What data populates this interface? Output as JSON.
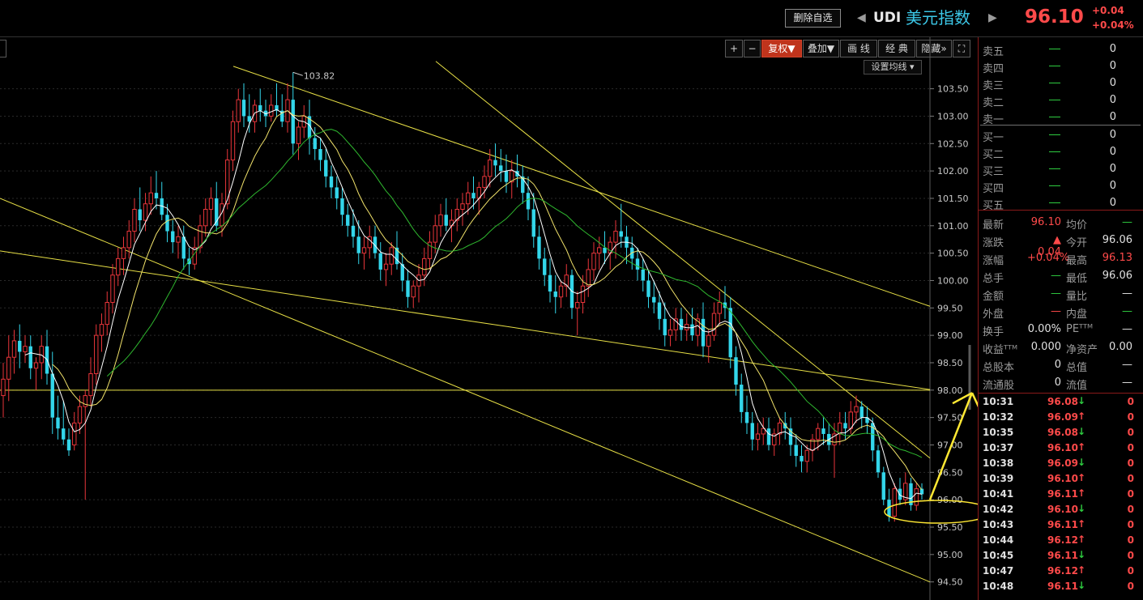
{
  "header": {
    "delete_btn": "删除自选",
    "prev_arrow": "◀",
    "next_arrow": "▶",
    "symbol": "UDI",
    "name": "美元指数",
    "price": "96.10",
    "change": "+0.04",
    "change_pct": "+0.04%"
  },
  "toolbar": {
    "items": [
      "+",
      "−",
      "复权▼",
      "叠加▼",
      "画 线",
      "经 典",
      "隐藏»",
      "⛶"
    ],
    "ma_setting": "设置均线 ▾"
  },
  "colors": {
    "up": "#e8353a",
    "down": "#33d6ea",
    "ma5": "#ffffff",
    "ma10": "#f2e36b",
    "ma20": "#2fb82f",
    "trend": "#e8e046",
    "annot": "#ffe833"
  },
  "chart_data": {
    "type": "candlestick",
    "ylim": [
      94.17,
      104.44
    ],
    "yticks": [
      "103.50",
      "103.00",
      "102.50",
      "102.00",
      "101.50",
      "101.00",
      "100.50",
      "100.00",
      "99.50",
      "99.00",
      "98.50",
      "98.00",
      "97.50",
      "97.00",
      "96.50",
      "96.00",
      "95.50",
      "95.00",
      "94.50"
    ],
    "high_marker": "103.82",
    "candles": [
      [
        97.9,
        98.5,
        97.5,
        98.2
      ],
      [
        98.2,
        99.0,
        97.8,
        98.6
      ],
      [
        98.6,
        99.1,
        98.3,
        98.9
      ],
      [
        98.9,
        99.2,
        98.4,
        98.7
      ],
      [
        98.7,
        99.0,
        98.5,
        98.8
      ],
      [
        98.8,
        99.0,
        98.2,
        98.4
      ],
      [
        98.4,
        98.6,
        98.0,
        98.5
      ],
      [
        98.5,
        99.0,
        98.2,
        98.8
      ],
      [
        98.8,
        99.1,
        98.1,
        98.3
      ],
      [
        98.3,
        98.7,
        97.2,
        97.5
      ],
      [
        97.5,
        97.9,
        97.1,
        97.3
      ],
      [
        97.3,
        97.8,
        97.0,
        97.1
      ],
      [
        97.1,
        97.3,
        96.8,
        96.9
      ],
      [
        97.0,
        97.6,
        96.9,
        97.4
      ],
      [
        97.4,
        97.9,
        97.2,
        97.7
      ],
      [
        97.7,
        98.0,
        96.0,
        97.9
      ],
      [
        97.9,
        98.6,
        97.7,
        98.3
      ],
      [
        98.3,
        99.2,
        98.1,
        99.0
      ],
      [
        99.0,
        99.4,
        98.7,
        99.2
      ],
      [
        99.2,
        99.8,
        99.0,
        99.6
      ],
      [
        99.6,
        100.3,
        99.4,
        100.1
      ],
      [
        100.1,
        100.6,
        99.9,
        100.4
      ],
      [
        100.4,
        100.8,
        100.1,
        100.6
      ],
      [
        100.6,
        101.1,
        100.4,
        100.9
      ],
      [
        100.9,
        101.5,
        100.7,
        101.3
      ],
      [
        101.3,
        101.7,
        100.9,
        101.1
      ],
      [
        101.1,
        101.6,
        100.9,
        101.4
      ],
      [
        101.4,
        101.9,
        101.2,
        101.6
      ],
      [
        101.6,
        102.0,
        101.3,
        101.5
      ],
      [
        101.5,
        101.8,
        101.1,
        101.2
      ],
      [
        101.2,
        101.4,
        100.7,
        100.9
      ],
      [
        100.9,
        101.1,
        100.5,
        100.7
      ],
      [
        100.7,
        101.0,
        100.4,
        100.8
      ],
      [
        100.8,
        101.0,
        100.2,
        100.4
      ],
      [
        100.4,
        100.6,
        100.1,
        100.3
      ],
      [
        100.3,
        100.8,
        100.2,
        100.6
      ],
      [
        100.6,
        101.2,
        100.5,
        101.0
      ],
      [
        101.0,
        101.5,
        100.8,
        101.3
      ],
      [
        101.3,
        101.7,
        101.0,
        101.5
      ],
      [
        101.5,
        101.8,
        100.9,
        101.0
      ],
      [
        101.0,
        101.6,
        100.8,
        101.4
      ],
      [
        101.4,
        102.4,
        101.3,
        102.2
      ],
      [
        102.2,
        103.1,
        102.0,
        102.9
      ],
      [
        102.9,
        103.5,
        102.7,
        103.3
      ],
      [
        103.3,
        103.6,
        102.8,
        103.0
      ],
      [
        103.0,
        103.4,
        102.7,
        102.9
      ],
      [
        102.9,
        103.3,
        102.7,
        103.2
      ],
      [
        103.2,
        103.5,
        102.9,
        103.1
      ],
      [
        103.1,
        103.3,
        102.8,
        103.0
      ],
      [
        103.0,
        103.4,
        102.9,
        103.2
      ],
      [
        103.2,
        103.6,
        103.0,
        103.1
      ],
      [
        103.1,
        103.4,
        102.8,
        102.9
      ],
      [
        102.9,
        103.6,
        102.7,
        103.3
      ],
      [
        103.3,
        103.8,
        102.3,
        102.5
      ],
      [
        102.5,
        102.9,
        102.2,
        102.8
      ],
      [
        102.8,
        103.2,
        102.6,
        103.0
      ],
      [
        103.0,
        103.3,
        102.3,
        102.6
      ],
      [
        102.6,
        102.8,
        102.2,
        102.4
      ],
      [
        102.4,
        102.6,
        102.0,
        102.2
      ],
      [
        102.2,
        102.4,
        101.7,
        101.9
      ],
      [
        101.9,
        102.1,
        101.5,
        101.7
      ],
      [
        101.7,
        101.9,
        101.3,
        101.5
      ],
      [
        101.5,
        101.7,
        101.0,
        101.2
      ],
      [
        101.2,
        101.4,
        100.8,
        101.0
      ],
      [
        101.0,
        101.3,
        100.6,
        100.8
      ],
      [
        100.8,
        101.1,
        100.3,
        100.5
      ],
      [
        100.5,
        100.8,
        100.2,
        100.6
      ],
      [
        100.6,
        101.0,
        100.4,
        100.8
      ],
      [
        100.8,
        101.0,
        100.4,
        100.5
      ],
      [
        100.5,
        100.7,
        100.0,
        100.2
      ],
      [
        100.2,
        100.5,
        99.9,
        100.3
      ],
      [
        100.3,
        100.7,
        100.1,
        100.6
      ],
      [
        100.6,
        100.9,
        100.2,
        100.3
      ],
      [
        100.3,
        100.5,
        99.8,
        100.0
      ],
      [
        100.0,
        100.2,
        99.5,
        99.7
      ],
      [
        99.7,
        100.0,
        99.5,
        99.9
      ],
      [
        99.9,
        100.3,
        99.6,
        100.1
      ],
      [
        100.1,
        100.6,
        99.9,
        100.4
      ],
      [
        100.4,
        100.9,
        100.2,
        100.7
      ],
      [
        100.7,
        101.2,
        100.5,
        101.0
      ],
      [
        101.0,
        101.4,
        100.8,
        101.2
      ],
      [
        101.2,
        101.5,
        100.9,
        101.0
      ],
      [
        101.0,
        101.3,
        100.7,
        101.1
      ],
      [
        101.1,
        101.5,
        100.9,
        101.3
      ],
      [
        101.3,
        101.6,
        101.0,
        101.4
      ],
      [
        101.4,
        101.8,
        101.2,
        101.6
      ],
      [
        101.6,
        101.9,
        101.3,
        101.5
      ],
      [
        101.5,
        101.8,
        101.2,
        101.7
      ],
      [
        101.7,
        102.1,
        101.5,
        101.9
      ],
      [
        101.9,
        102.4,
        101.7,
        102.2
      ],
      [
        102.2,
        102.5,
        101.9,
        102.1
      ],
      [
        102.1,
        102.4,
        101.8,
        102.0
      ],
      [
        102.0,
        102.3,
        101.6,
        101.8
      ],
      [
        101.8,
        102.2,
        101.5,
        102.0
      ],
      [
        102.0,
        102.3,
        101.7,
        101.9
      ],
      [
        101.9,
        102.1,
        101.4,
        101.6
      ],
      [
        101.6,
        101.9,
        101.1,
        101.3
      ],
      [
        101.3,
        101.6,
        100.6,
        100.8
      ],
      [
        100.8,
        101.0,
        100.2,
        100.4
      ],
      [
        100.4,
        100.6,
        99.9,
        100.1
      ],
      [
        100.1,
        100.4,
        99.6,
        99.8
      ],
      [
        99.8,
        100.1,
        99.4,
        99.7
      ],
      [
        99.7,
        100.0,
        99.5,
        99.9
      ],
      [
        99.9,
        100.3,
        99.7,
        100.1
      ],
      [
        100.1,
        100.2,
        99.3,
        99.5
      ],
      [
        99.5,
        99.8,
        99.0,
        99.6
      ],
      [
        99.6,
        100.1,
        99.4,
        99.9
      ],
      [
        99.9,
        100.4,
        99.7,
        100.2
      ],
      [
        100.2,
        100.7,
        100.0,
        100.5
      ],
      [
        100.5,
        100.8,
        100.2,
        100.6
      ],
      [
        100.6,
        100.9,
        100.3,
        100.5
      ],
      [
        100.5,
        100.8,
        100.2,
        100.7
      ],
      [
        100.7,
        101.1,
        100.4,
        100.9
      ],
      [
        100.9,
        101.4,
        100.6,
        100.8
      ],
      [
        100.8,
        101.0,
        100.3,
        100.6
      ],
      [
        100.6,
        100.8,
        100.2,
        100.4
      ],
      [
        100.4,
        100.6,
        100.0,
        100.2
      ],
      [
        100.2,
        100.4,
        99.8,
        100.0
      ],
      [
        100.0,
        100.2,
        99.5,
        99.7
      ],
      [
        99.7,
        100.0,
        99.4,
        99.6
      ],
      [
        99.6,
        99.8,
        99.1,
        99.3
      ],
      [
        99.3,
        99.6,
        98.8,
        99.0
      ],
      [
        99.0,
        99.3,
        98.8,
        99.1
      ],
      [
        99.1,
        99.5,
        98.9,
        99.3
      ],
      [
        99.3,
        99.5,
        98.9,
        99.1
      ],
      [
        99.1,
        99.4,
        98.9,
        99.2
      ],
      [
        99.2,
        99.5,
        98.9,
        99.0
      ],
      [
        99.0,
        99.4,
        98.8,
        99.3
      ],
      [
        99.3,
        99.6,
        98.6,
        98.8
      ],
      [
        98.8,
        99.1,
        98.5,
        99.0
      ],
      [
        99.0,
        99.6,
        98.9,
        99.4
      ],
      [
        99.4,
        99.8,
        99.2,
        99.6
      ],
      [
        99.6,
        99.9,
        99.3,
        99.5
      ],
      [
        99.5,
        99.7,
        98.4,
        98.6
      ],
      [
        98.6,
        98.8,
        97.9,
        98.1
      ],
      [
        98.1,
        98.3,
        97.4,
        97.6
      ],
      [
        97.6,
        97.9,
        97.2,
        97.4
      ],
      [
        97.4,
        97.6,
        96.9,
        97.1
      ],
      [
        97.1,
        97.4,
        96.9,
        97.2
      ],
      [
        97.2,
        97.5,
        97.0,
        97.3
      ],
      [
        97.3,
        97.5,
        96.9,
        97.0
      ],
      [
        97.0,
        97.3,
        96.8,
        97.2
      ],
      [
        97.2,
        97.5,
        97.0,
        97.4
      ],
      [
        97.4,
        97.6,
        97.1,
        97.3
      ],
      [
        97.3,
        97.5,
        96.8,
        97.0
      ],
      [
        97.0,
        97.2,
        96.6,
        96.8
      ],
      [
        96.8,
        97.0,
        96.5,
        96.7
      ],
      [
        96.7,
        97.0,
        96.5,
        96.9
      ],
      [
        96.9,
        97.2,
        96.7,
        97.1
      ],
      [
        97.1,
        97.4,
        96.9,
        97.3
      ],
      [
        97.3,
        97.5,
        97.0,
        97.2
      ],
      [
        97.2,
        97.4,
        96.9,
        97.0
      ],
      [
        97.0,
        97.4,
        96.4,
        97.2
      ],
      [
        97.2,
        97.6,
        97.0,
        97.4
      ],
      [
        97.4,
        97.6,
        97.1,
        97.3
      ],
      [
        97.3,
        97.8,
        97.2,
        97.6
      ],
      [
        97.6,
        97.9,
        97.4,
        97.7
      ],
      [
        97.7,
        97.8,
        97.3,
        97.5
      ],
      [
        97.5,
        97.7,
        97.2,
        97.4
      ],
      [
        97.4,
        97.5,
        96.7,
        96.9
      ],
      [
        96.9,
        97.0,
        96.4,
        96.5
      ],
      [
        96.5,
        96.6,
        95.9,
        96.0
      ],
      [
        96.0,
        96.2,
        95.6,
        95.7
      ],
      [
        95.7,
        96.3,
        95.6,
        96.2
      ],
      [
        96.2,
        96.4,
        95.9,
        96.0
      ],
      [
        96.0,
        96.5,
        95.9,
        96.3
      ],
      [
        96.3,
        96.4,
        95.8,
        95.9
      ],
      [
        95.9,
        96.3,
        95.8,
        96.2
      ],
      [
        96.2,
        96.3,
        96.0,
        96.1
      ]
    ]
  },
  "order_book": {
    "asks": [
      {
        "label": "卖五",
        "vol": "0"
      },
      {
        "label": "卖四",
        "vol": "0"
      },
      {
        "label": "卖三",
        "vol": "0"
      },
      {
        "label": "卖二",
        "vol": "0"
      },
      {
        "label": "卖一",
        "vol": "0"
      }
    ],
    "bids": [
      {
        "label": "买一",
        "vol": "0"
      },
      {
        "label": "买二",
        "vol": "0"
      },
      {
        "label": "买三",
        "vol": "0"
      },
      {
        "label": "买四",
        "vol": "0"
      },
      {
        "label": "买五",
        "vol": "0"
      }
    ]
  },
  "quote": {
    "rows": [
      {
        "l1": "最新",
        "v1": "96.10",
        "l2": "均价",
        "v2": "—"
      },
      {
        "l1": "涨跌",
        "v1": "▲ 0.04",
        "l2": "今开",
        "v2": "96.06"
      },
      {
        "l1": "涨幅",
        "v1": "+0.04%",
        "l2": "最高",
        "v2": "96.13"
      },
      {
        "l1": "总手",
        "v1": "—",
        "l2": "最低",
        "v2": "96.06"
      },
      {
        "l1": "金额",
        "v1": "—",
        "l2": "量比",
        "v2": "—"
      },
      {
        "l1": "外盘",
        "v1": "—",
        "l2": "内盘",
        "v2": "—"
      },
      {
        "l1": "换手",
        "v1": "0.00%",
        "l2": "PEᵀᵀᴹ",
        "v2": "—"
      },
      {
        "l1": "收益ᵀᵀᴹ",
        "v1": "0.000",
        "l2": "净资产",
        "v2": "0.00"
      },
      {
        "l1": "总股本",
        "v1": "0",
        "l2": "总值",
        "v2": "—"
      },
      {
        "l1": "流通股",
        "v1": "0",
        "l2": "流值",
        "v2": "—"
      }
    ]
  },
  "ticks": [
    {
      "time": "10:31",
      "price": "96.08",
      "dir": "↓",
      "vol": "0"
    },
    {
      "time": "10:32",
      "price": "96.09",
      "dir": "↑",
      "vol": "0"
    },
    {
      "time": "10:35",
      "price": "96.08",
      "dir": "↓",
      "vol": "0"
    },
    {
      "time": "10:37",
      "price": "96.10",
      "dir": "↑",
      "vol": "0"
    },
    {
      "time": "10:38",
      "price": "96.09",
      "dir": "↓",
      "vol": "0"
    },
    {
      "time": "10:39",
      "price": "96.10",
      "dir": "↑",
      "vol": "0"
    },
    {
      "time": "10:41",
      "price": "96.11",
      "dir": "↑",
      "vol": "0"
    },
    {
      "time": "10:42",
      "price": "96.10",
      "dir": "↓",
      "vol": "0"
    },
    {
      "time": "10:43",
      "price": "96.11",
      "dir": "↑",
      "vol": "0"
    },
    {
      "time": "10:44",
      "price": "96.12",
      "dir": "↑",
      "vol": "0"
    },
    {
      "time": "10:45",
      "price": "96.11",
      "dir": "↓",
      "vol": "0"
    },
    {
      "time": "10:47",
      "price": "96.12",
      "dir": "↑",
      "vol": "0"
    },
    {
      "time": "10:48",
      "price": "96.11",
      "dir": "↓",
      "vol": "0"
    }
  ]
}
